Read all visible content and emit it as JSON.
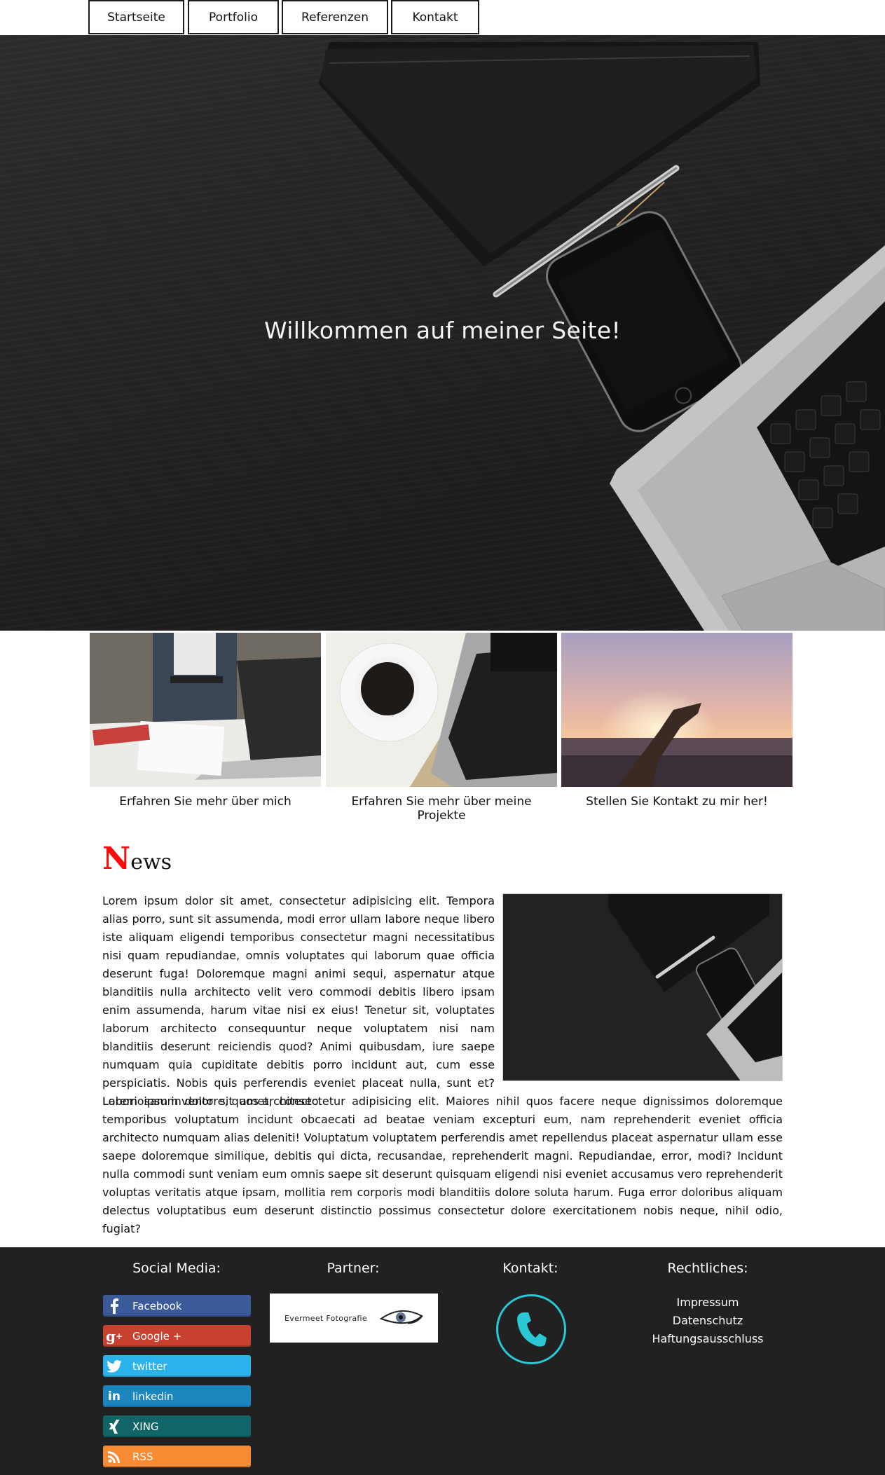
{
  "nav": {
    "items": [
      {
        "label": "Startseite"
      },
      {
        "label": "Portfolio"
      },
      {
        "label": "Referenzen"
      },
      {
        "label": "Kontakt"
      }
    ]
  },
  "hero": {
    "title": "Willkommen auf meiner Seite!"
  },
  "tiles": [
    {
      "caption": "Erfahren Sie mehr über mich"
    },
    {
      "caption": "Erfahren Sie mehr über meine Projekte"
    },
    {
      "caption": "Stellen Sie Kontakt zu mir her!"
    }
  ],
  "news": {
    "heading_initial": "N",
    "heading_rest": "ews",
    "paragraph_1": "Lorem ipsum dolor sit amet, consectetur adipisicing elit. Tempora alias porro, sunt sit assumenda, modi error ullam labore neque libero iste aliquam eligendi temporibus consectetur magni necessitatibus nisi quam repudiandae, omnis voluptates qui laborum quae officia deserunt fuga! Doloremque magni animi sequi, aspernatur atque blanditiis nulla architecto velit vero commodi debitis libero ipsam enim assumenda, harum vitae nisi ex eius! Tenetur sit, voluptates laborum architecto consequuntur neque voluptatem nisi nam blanditiis deserunt reiciendis quod? Animi quibusdam, iure saepe numquam quia cupiditate debitis porro incidunt aut, cum esse perspiciatis. Nobis quis perferendis eveniet placeat nulla, sunt et? Laboriosam inventore, quos architecto.",
    "paragraph_2": "Lorem ipsum dolor sit amet, consectetur adipisicing elit. Maiores nihil quos facere neque dignissimos doloremque temporibus voluptatum incidunt obcaecati ad beatae veniam excepturi eum, nam reprehenderit eveniet officia architecto numquam alias deleniti! Voluptatum voluptatem perferendis amet repellendus placeat aspernatur ullam esse saepe doloremque similique, debitis qui dicta, recusandae, reprehenderit magni. Repudiandae, error, modi? Incidunt nulla commodi sunt veniam eum omnis saepe sit deserunt quisquam eligendi nisi eveniet accusamus vero reprehenderit voluptas veritatis atque ipsam, mollitia rem corporis modi blanditiis dolore soluta harum. Fuga error doloribus aliquam delectus voluptatibus eum deserunt distinctio possimus consectetur dolore exercitationem nobis neque, nihil odio, fugiat?"
  },
  "footer": {
    "social_heading": "Social Media:",
    "partner_heading": "Partner:",
    "contact_heading": "Kontakt:",
    "legal_heading": "Rechtliches:",
    "social": [
      {
        "label": "Facebook",
        "icon": "facebook-icon",
        "color": "#3b5a9a"
      },
      {
        "label": "Google +",
        "icon": "google-plus-icon",
        "color": "#c8412f"
      },
      {
        "label": "twitter",
        "icon": "twitter-icon",
        "color": "#2cb2ea"
      },
      {
        "label": "linkedin",
        "icon": "linkedin-icon",
        "color": "#1b86bd"
      },
      {
        "label": "XING",
        "icon": "xing-icon",
        "color": "#126567"
      },
      {
        "label": "RSS",
        "icon": "rss-icon",
        "color": "#f68b33"
      }
    ],
    "partner_name": "Evermeet Fotografie",
    "phone_icon": "phone-icon",
    "phone_color": "#2ac7d4",
    "legal_links": [
      {
        "label": "Impressum"
      },
      {
        "label": "Datenschutz"
      },
      {
        "label": "Haftungsausschluss"
      }
    ]
  },
  "colors": {
    "news_initial": "#ff0a0a",
    "footer_bg": "#212121"
  }
}
